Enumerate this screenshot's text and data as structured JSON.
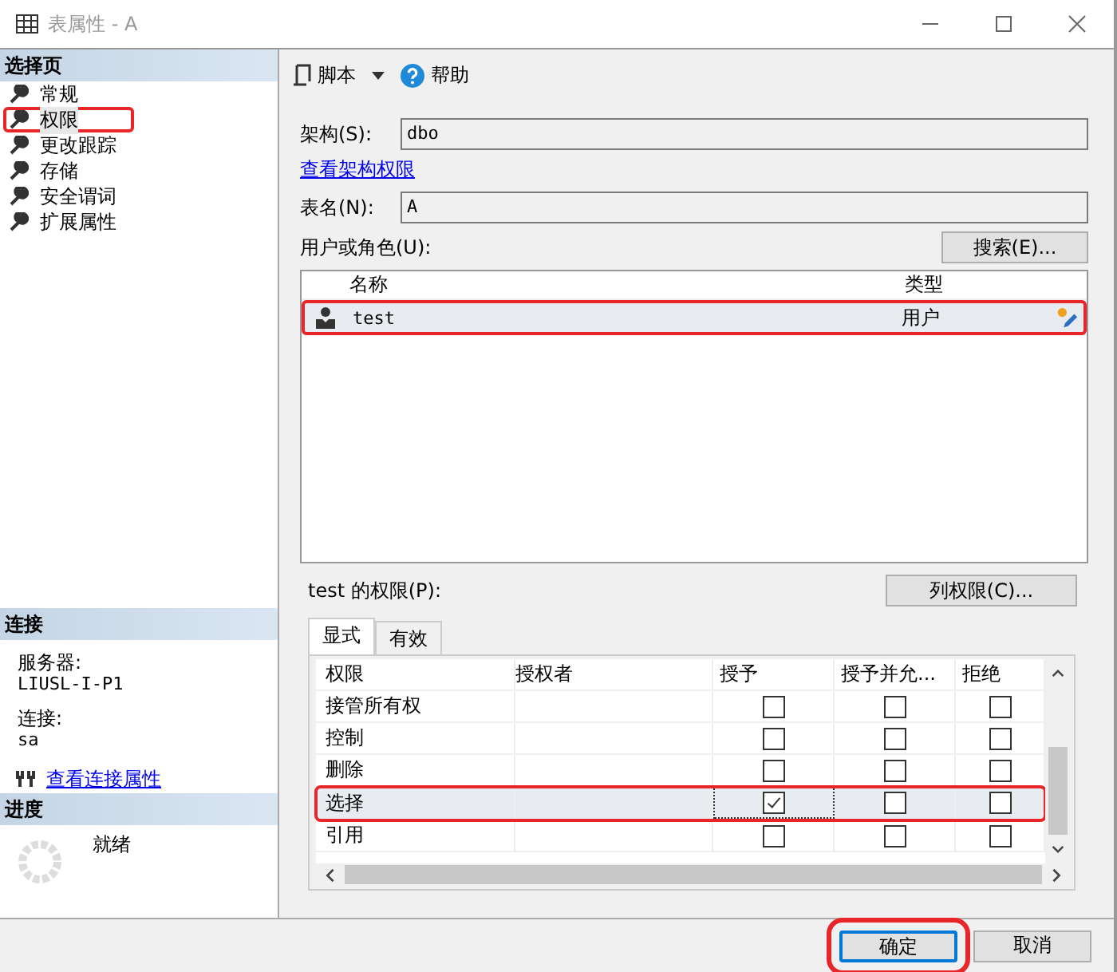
{
  "window": {
    "title": "表属性 - A"
  },
  "sidebar": {
    "header": "选择页",
    "items": [
      {
        "label": "常规",
        "selected": false,
        "highlighted": false
      },
      {
        "label": "权限",
        "selected": true,
        "highlighted": true
      },
      {
        "label": "更改跟踪",
        "selected": false,
        "highlighted": false
      },
      {
        "label": "存储",
        "selected": false,
        "highlighted": false
      },
      {
        "label": "安全谓词",
        "selected": false,
        "highlighted": false
      },
      {
        "label": "扩展属性",
        "selected": false,
        "highlighted": false
      }
    ]
  },
  "connection": {
    "header": "连接",
    "server_label": "服务器:",
    "server": "LIUSL-I-P1",
    "connection_label": "连接:",
    "connection": "sa",
    "link": "查看连接属性"
  },
  "progress": {
    "header": "进度",
    "status": "就绪"
  },
  "toolbar": {
    "script": "脚本",
    "help": "帮助"
  },
  "schema": {
    "label": "架构(S):",
    "value": "dbo",
    "link": "查看架构权限"
  },
  "table_name": {
    "label": "表名(N):",
    "value": "A"
  },
  "users": {
    "label": "用户或角色(U):",
    "search_button": "搜索(E)...",
    "columns": [
      "名称",
      "类型"
    ],
    "rows": [
      {
        "name": "test",
        "type": "用户",
        "selected": true,
        "highlighted": true
      }
    ]
  },
  "permissions": {
    "label": "test 的权限(P):",
    "column_button": "列权限(C)...",
    "tabs": [
      {
        "label": "显式",
        "selected": true
      },
      {
        "label": "有效",
        "selected": false
      }
    ],
    "columns": [
      "权限",
      "授权者",
      "授予",
      "授予并允...",
      "拒绝"
    ],
    "rows": [
      {
        "permission": "接管所有权",
        "grant": false,
        "with_grant": false,
        "deny": false,
        "selected": false,
        "highlighted": false
      },
      {
        "permission": "控制",
        "grant": false,
        "with_grant": false,
        "deny": false,
        "selected": false,
        "highlighted": false
      },
      {
        "permission": "删除",
        "grant": false,
        "with_grant": false,
        "deny": false,
        "selected": false,
        "highlighted": false
      },
      {
        "permission": "选择",
        "grant": true,
        "with_grant": false,
        "deny": false,
        "selected": true,
        "highlighted": true
      },
      {
        "permission": "引用",
        "grant": false,
        "with_grant": false,
        "deny": false,
        "selected": false,
        "highlighted": false
      }
    ]
  },
  "buttons": [
    {
      "label": "确定",
      "default": true,
      "highlighted": true
    },
    {
      "label": "取消",
      "default": false,
      "highlighted": false
    }
  ]
}
